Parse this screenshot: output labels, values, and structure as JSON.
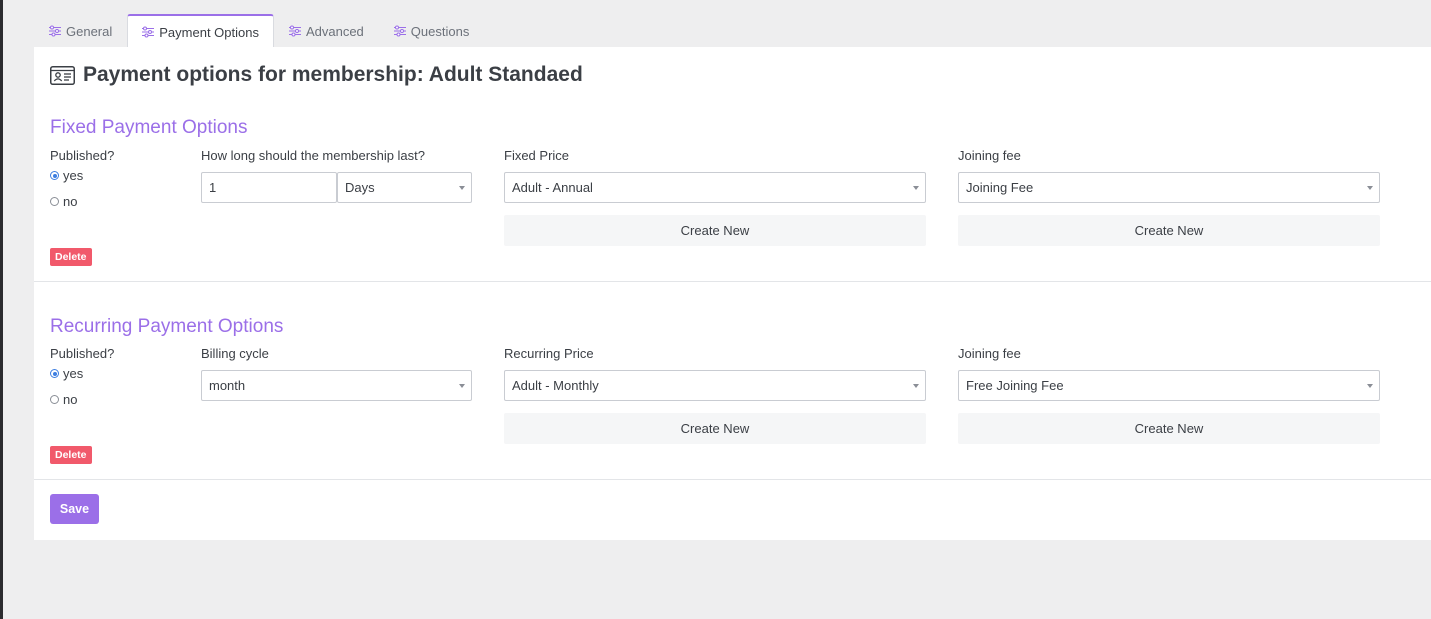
{
  "tabs": [
    {
      "label": "General",
      "icon": "sliders-icon",
      "active": false
    },
    {
      "label": "Payment Options",
      "icon": "sliders-icon",
      "active": true
    },
    {
      "label": "Advanced",
      "icon": "sliders-icon",
      "active": false
    },
    {
      "label": "Questions",
      "icon": "sliders-icon",
      "active": false
    }
  ],
  "page": {
    "title": "Payment options for membership: Adult Standaed",
    "icon": "id-card-icon"
  },
  "fixed": {
    "title": "Fixed Payment Options",
    "published_label": "Published?",
    "yes_label": "yes",
    "no_label": "no",
    "published_value": "yes",
    "duration_label": "How long should the membership last?",
    "duration_value": "1",
    "duration_unit": "Days",
    "price_label": "Fixed Price",
    "price_value": "Adult - Annual",
    "price_create": "Create New",
    "fee_label": "Joining fee",
    "fee_value": "Joining Fee",
    "fee_create": "Create New",
    "delete_label": "Delete"
  },
  "recurring": {
    "title": "Recurring Payment Options",
    "published_label": "Published?",
    "yes_label": "yes",
    "no_label": "no",
    "published_value": "yes",
    "cycle_label": "Billing cycle",
    "cycle_value": "month",
    "price_label": "Recurring Price",
    "price_value": "Adult - Monthly",
    "price_create": "Create New",
    "fee_label": "Joining fee",
    "fee_value": "Free Joining Fee",
    "fee_create": "Create New",
    "delete_label": "Delete"
  },
  "save_label": "Save",
  "colors": {
    "accent": "#9b6fe8",
    "danger": "#f1596b",
    "radio_checked": "#3d7ee0"
  }
}
